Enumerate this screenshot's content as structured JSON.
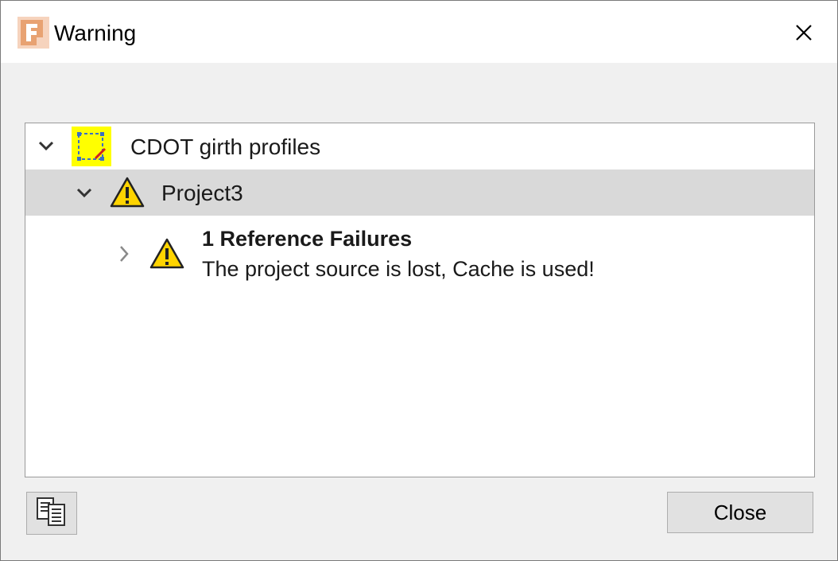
{
  "window": {
    "title": "Warning",
    "app_icon": "app-logo-icon",
    "close_icon": "close-icon"
  },
  "tree": {
    "items": [
      {
        "label": "CDOT girth profiles",
        "icon": "model-file-icon",
        "expanded": true,
        "selected": false
      },
      {
        "label": "Project3",
        "icon": "warning-icon",
        "expanded": true,
        "selected": true
      },
      {
        "title": "1 Reference Failures",
        "message": "The project source is lost, Cache is used!",
        "icon": "warning-icon",
        "expanded": false
      }
    ]
  },
  "footer": {
    "copy_button_icon": "copy-details-icon",
    "close_label": "Close"
  },
  "colors": {
    "selected_row": "#d9d9d9",
    "warning_yellow": "#ffd400",
    "model_icon_bg": "#ffff00",
    "app_icon_orange": "#e8a272"
  }
}
